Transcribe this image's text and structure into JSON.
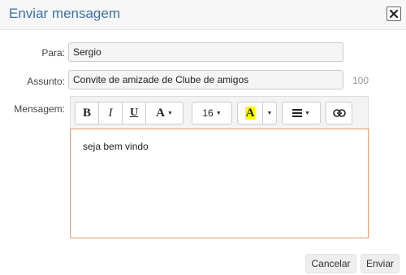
{
  "dialog": {
    "title": "Enviar mensagem",
    "close_icon": "close-icon"
  },
  "form": {
    "to_label": "Para:",
    "to_value": "Sergio",
    "subject_label": "Assunto:",
    "subject_value": "Convite de amizade de Clube de amigos",
    "subject_counter": "100",
    "message_label": "Mensagem:"
  },
  "toolbar": {
    "bold": "B",
    "italic": "I",
    "underline": "U",
    "font_color": "A",
    "font_size": "16",
    "highlight": "A",
    "highlight_color": "#ffff00",
    "align_icon": "align-left-icon",
    "link_icon": "link-icon"
  },
  "editor": {
    "content": "seja bem vindo",
    "border_color": "#e39a63"
  },
  "footer": {
    "cancel_label": "Cancelar",
    "send_label": "Enviar"
  }
}
